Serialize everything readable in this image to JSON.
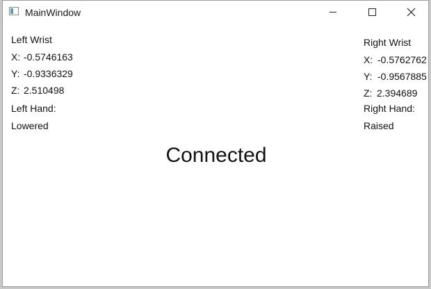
{
  "window": {
    "title": "MainWindow"
  },
  "left": {
    "heading": "Left Wrist",
    "x_label": "X:",
    "x_value": "-0.5746163",
    "y_label": "Y:",
    "y_value": "-0.9336329",
    "z_label": "Z:",
    "z_value": "2.510498",
    "hand_label": "Left Hand:",
    "hand_state": "Lowered"
  },
  "right": {
    "heading": "Right Wrist",
    "x_label": "X:",
    "x_value": "-0.5762762",
    "y_label": "Y:",
    "y_value": "-0.9567885",
    "z_label": "Z:",
    "z_value": "2.394689",
    "hand_label": "Right Hand:",
    "hand_state": "Raised"
  },
  "status": "Connected",
  "icons": {
    "app": "window-app-icon",
    "minimize": "minimize-icon",
    "maximize": "maximize-icon",
    "close": "close-icon"
  }
}
